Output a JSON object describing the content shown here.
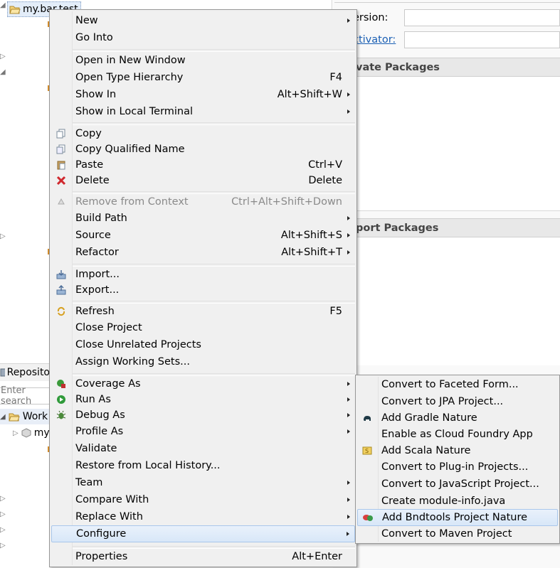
{
  "tree": {
    "root_label": "my.bar.test",
    "repo_tab_label": "Reposito",
    "filter_placeholder": "Enter search",
    "work_label": "Work",
    "my_label": "my"
  },
  "form": {
    "version_label": "ersion:",
    "activator_label": "ctivator:",
    "private_packages": "vate Packages",
    "import_packages": "port Packages"
  },
  "menu": {
    "new": "New",
    "go_into": "Go Into",
    "open_new_window": "Open in New Window",
    "open_type_hierarchy": "Open Type Hierarchy",
    "open_type_hierarchy_acc": "F4",
    "show_in": "Show In",
    "show_in_acc": "Alt+Shift+W",
    "show_local_terminal": "Show in Local Terminal",
    "copy": "Copy",
    "copy_qualified": "Copy Qualified Name",
    "paste": "Paste",
    "paste_acc": "Ctrl+V",
    "delete": "Delete",
    "delete_acc": "Delete",
    "remove_context": "Remove from Context",
    "remove_context_acc": "Ctrl+Alt+Shift+Down",
    "build_path": "Build Path",
    "source": "Source",
    "source_acc": "Alt+Shift+S",
    "refactor": "Refactor",
    "refactor_acc": "Alt+Shift+T",
    "import": "Import...",
    "export": "Export...",
    "refresh": "Refresh",
    "refresh_acc": "F5",
    "close_project": "Close Project",
    "close_unrelated": "Close Unrelated Projects",
    "assign_working_sets": "Assign Working Sets...",
    "coverage_as": "Coverage As",
    "run_as": "Run As",
    "debug_as": "Debug As",
    "profile_as": "Profile As",
    "validate": "Validate",
    "restore_local_history": "Restore from Local History...",
    "team": "Team",
    "compare_with": "Compare With",
    "replace_with": "Replace With",
    "configure": "Configure",
    "properties": "Properties",
    "properties_acc": "Alt+Enter"
  },
  "submenu": {
    "faceted_form": "Convert to Faceted Form...",
    "jpa_project": "Convert to JPA Project...",
    "gradle_nature": "Add Gradle Nature",
    "cloud_foundry": "Enable as Cloud Foundry App",
    "scala_nature": "Add Scala Nature",
    "plugin_projects": "Convert to Plug-in Projects...",
    "javascript_project": "Convert to JavaScript Project...",
    "module_info": "Create module-info.java",
    "bndtools_nature": "Add Bndtools Project Nature",
    "maven_project": "Convert to Maven Project"
  },
  "colors": {
    "menu_bg": "#f0f0f0",
    "highlight": "#d8e7f8",
    "link": "#1a5fb4"
  }
}
